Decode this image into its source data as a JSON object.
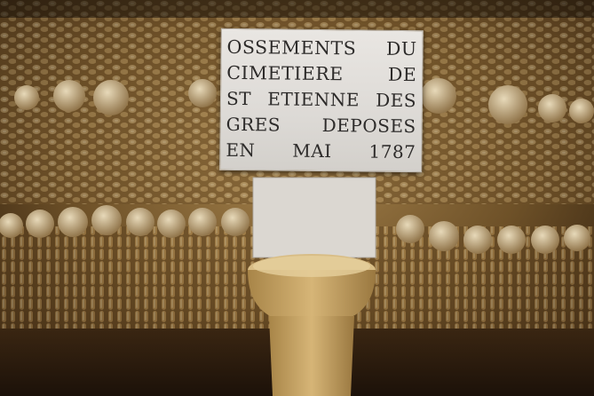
{
  "plaque": {
    "lines": [
      "OSSEMENTS DU",
      "CIMETIERE DE",
      "ST ETIENNE DES",
      "GRES DEPOSES",
      "EN MAI 1787"
    ]
  },
  "colors": {
    "bone_wall": "#8a6a3c",
    "bone_highlight": "#d8c6a2",
    "plaque_stone": "#e3e0dc",
    "inscription": "#2d2b2a",
    "floor": "#2a1a0d"
  }
}
